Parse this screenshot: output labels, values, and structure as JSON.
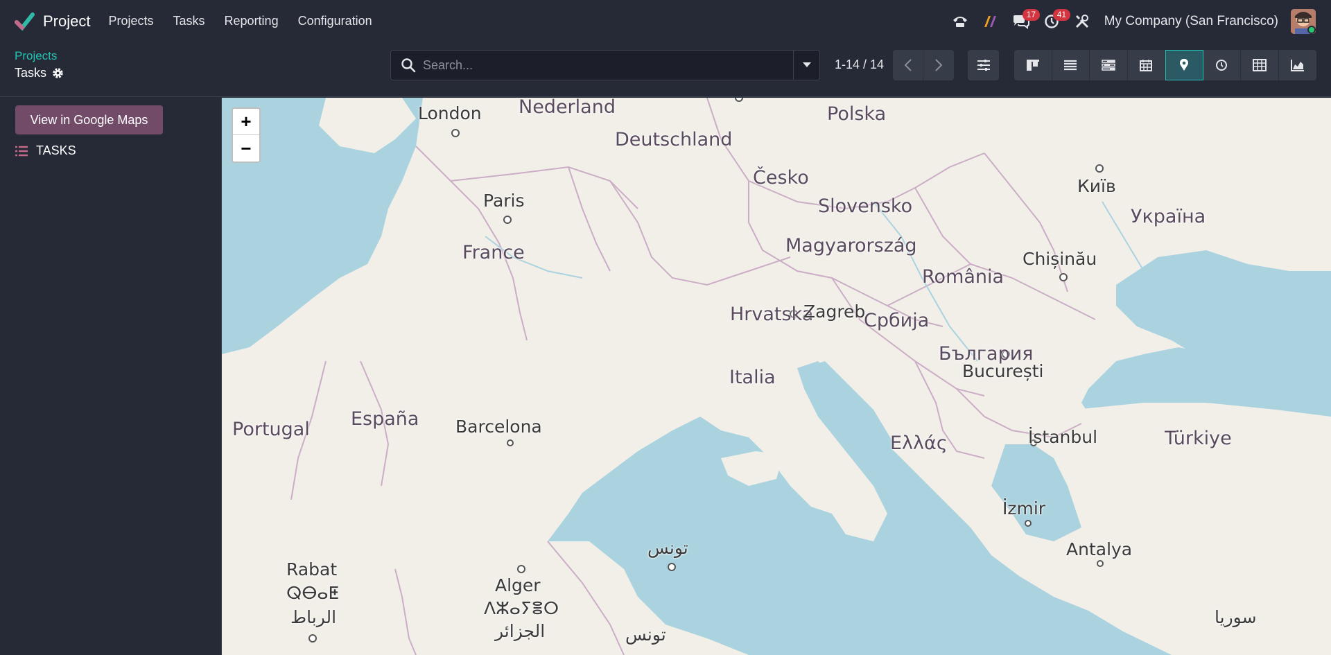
{
  "navbar": {
    "app_name": "Project",
    "menu": [
      "Projects",
      "Tasks",
      "Reporting",
      "Configuration"
    ],
    "messages_count": "17",
    "activities_count": "41",
    "company": "My Company (San Francisco)"
  },
  "control_panel": {
    "breadcrumb_parent": "Projects",
    "current": "Tasks",
    "search_placeholder": "Search...",
    "pager": "1-14 / 14",
    "active_view": "map"
  },
  "sidebar": {
    "google_maps_button": "View in Google Maps",
    "tasks_label": "TASKS"
  },
  "map": {
    "zoom_in": "+",
    "zoom_out": "−",
    "countries": [
      "Nederland",
      "Deutschland",
      "Polska",
      "Česko",
      "Slovensko",
      "Україна",
      "Magyarország",
      "France",
      "România",
      "Hrvatska",
      "Србија",
      "Italia",
      "България",
      "España",
      "Portugal",
      "Ελλάς",
      "Türkiye"
    ],
    "cities": [
      "London",
      "Paris",
      "Київ",
      "Chișinău",
      "Zagreb",
      "București",
      "Barcelona",
      "İstanbul",
      "İzmir",
      "Antalya",
      "تونس",
      "Rabat",
      "ⵕⴱⴰⵟ",
      "الرباط",
      "Alger",
      "ⴷⵣⴰⵢⴻⵔ",
      "الجزائر",
      "تونس",
      "سوريا"
    ]
  }
}
